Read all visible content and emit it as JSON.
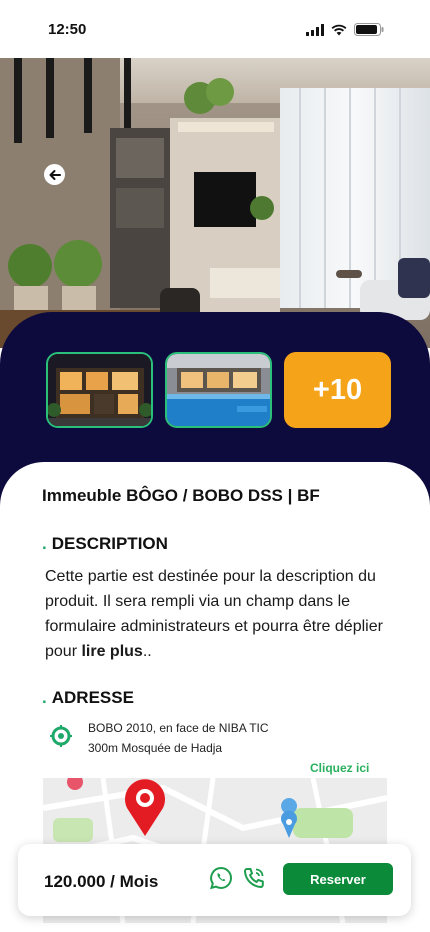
{
  "status_bar": {
    "time": "12:50",
    "icons": [
      "cellular-signal-icon",
      "wifi-icon",
      "battery-icon"
    ]
  },
  "hero": {
    "back_icon": "arrow-left-icon"
  },
  "gallery": {
    "more_label": "+10",
    "thumb_border_color": "#2bc07a",
    "more_color": "#f5a318",
    "panel_color": "#0d0a3d"
  },
  "property": {
    "title": "Immeuble BÔGO / BOBO DSS | BF"
  },
  "description": {
    "heading": "DESCRIPTION",
    "dot": ".",
    "text": "Cette partie est destinée pour la description du produit. Il sera rempli via un champ dans le formulaire administrateurs et pourra être déplier pour ",
    "read_more": "lire plus",
    "suffix": ".."
  },
  "address": {
    "heading": "ADRESSE",
    "dot": ".",
    "line1": "BOBO 2010, en face de NIBA TIC",
    "line2": "300m Mosquée de Hadja",
    "icon": "location-target-icon",
    "map_link": "Cliquez ici"
  },
  "footer": {
    "price": "120.000 / Mois",
    "whatsapp_icon": "whatsapp-icon",
    "call_icon": "phone-call-icon",
    "reserve_label": "Reserver",
    "accent": "#0b8a39"
  }
}
